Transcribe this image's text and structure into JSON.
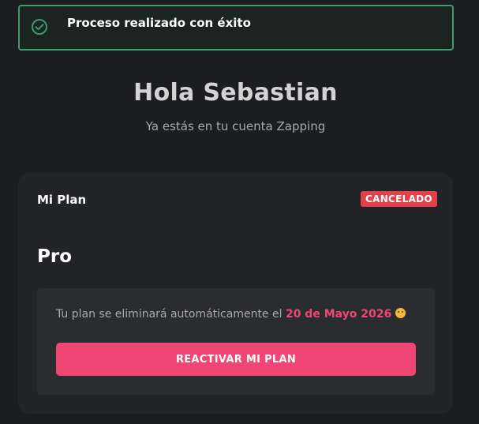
{
  "toast": {
    "icon": "check-circle-icon",
    "message": "Proceso realizado con éxito",
    "color": "#3c9a6d"
  },
  "header": {
    "greeting": "Hola Sebastian",
    "subtitle": "Ya estás en tu cuenta Zapping"
  },
  "plan_card": {
    "title": "Mi Plan",
    "status": "CANCELADO",
    "status_color": "#e0414b",
    "plan_name": "Pro",
    "notice_prefix": "Tu plan se eliminará automáticamente el ",
    "notice_date": "20 de Mayo 2026",
    "notice_emoji": "smiling-face-emoji",
    "reactivate_label": "REACTIVAR MI PLAN",
    "accent_color": "#ef4673"
  }
}
